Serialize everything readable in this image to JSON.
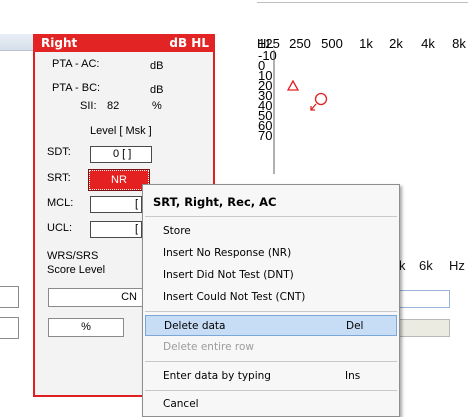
{
  "panel": {
    "side": "Right",
    "unit": "dB HL",
    "pta_ac_label": "PTA - AC:",
    "pta_ac_unit": "dB",
    "pta_bc_label": "PTA - BC:",
    "pta_bc_unit": "dB",
    "sii_label": "SII:",
    "sii_value": "82",
    "sii_unit": "%",
    "level_heading": "Level [ Msk ]",
    "sdt_label": "SDT:",
    "sdt_value": "0 [       ]",
    "srt_label": "SRT:",
    "srt_value": "NR",
    "mcl_label": "MCL:",
    "mcl_value": "[",
    "ucl_label": "UCL:",
    "ucl_value": "[",
    "wrs_label": "WRS/SRS",
    "score_level_label": "Score Level",
    "cnt_value": "CN",
    "percent_value": "%"
  },
  "audiogram": {
    "hl_label": "HL",
    "freq_labels_top": [
      "125",
      "250",
      "500",
      "1k",
      "2k",
      "4k",
      "8k"
    ],
    "freq_labels_bottom_partial": [
      "k",
      "6k",
      "Hz"
    ],
    "db_ticks": [
      "-10",
      "0",
      "10",
      "20",
      "30",
      "40",
      "50",
      "60",
      "70"
    ],
    "marker_colors": {
      "triangle": "#e02020",
      "circle": "#e02020"
    }
  },
  "context_menu": {
    "title": "SRT, Right, Rec, AC",
    "items": [
      {
        "label": "Store",
        "shortcut": ""
      },
      {
        "label": "Insert No Response (NR)",
        "shortcut": ""
      },
      {
        "label": "Insert Did Not Test (DNT)",
        "shortcut": ""
      },
      {
        "label": "Insert Could Not Test (CNT)",
        "shortcut": ""
      },
      {
        "label": "Delete data",
        "shortcut": "Del"
      },
      {
        "label": "Delete entire row",
        "shortcut": ""
      },
      {
        "label": "Enter data by typing",
        "shortcut": "Ins"
      },
      {
        "label": "Cancel",
        "shortcut": ""
      }
    ]
  },
  "colors": {
    "accent_red": "#e32424",
    "menu_highlight": "#c7ddf5"
  }
}
